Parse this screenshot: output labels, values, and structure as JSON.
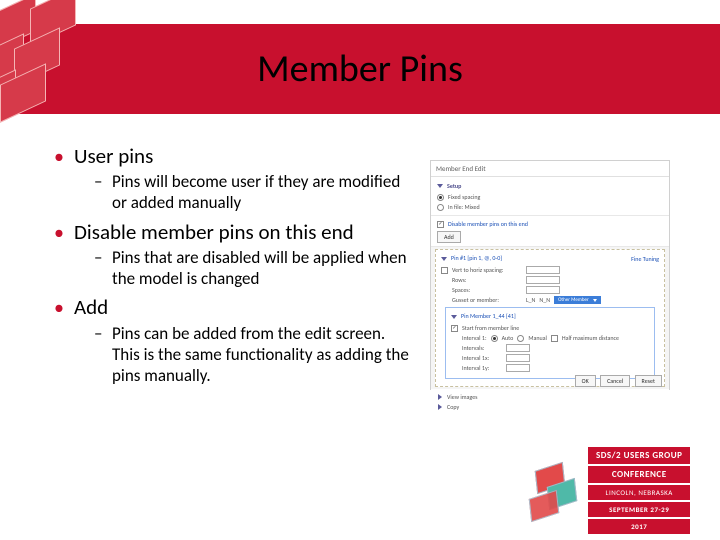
{
  "title": "Member Pins",
  "bullets": [
    {
      "label": "User pins",
      "subs": [
        "Pins will become user if they are modified or added manually"
      ]
    },
    {
      "label": "Disable member pins on this end",
      "subs": [
        "Pins that are disabled will be applied when the model is changed"
      ]
    },
    {
      "label": "Add",
      "subs": [
        "Pins can be added from the edit screen. This is the same functionality as adding the pins manually."
      ]
    }
  ],
  "screenshot": {
    "window_title": "Member End Edit",
    "tab1": "Setup",
    "radio1": "Fixed spacing",
    "radio2": "In file: Mixed",
    "toggle_dis": "Disable member pins on this end",
    "add_btn": "Add",
    "pin_group_title": "Pin #1 [pin 1, @, 0-0]",
    "fine_tuning": "Fine Tuning",
    "vert_spacing_row": "Vert to horiz spacing:",
    "rows_row": "Rows:",
    "spaces_row": "Spaces:",
    "gusset_row": "Gusset or member:",
    "gusset_val_a": "L_N",
    "gusset_val_b": "N_N",
    "dropdown_val": "Other Member",
    "member_title": "Pin Member 1_44 [41]",
    "start_row": "Start from member line",
    "interval_label": "Interval 1:",
    "interval_auto": "Auto",
    "interval_manual": "Manual",
    "half_label": "Half maximum distance",
    "intervals": "Intervals:",
    "interval_1x": "Interval 1x:",
    "interval_1y": "Interval 1y:",
    "bottom_view": "View images",
    "bottom_copy": "Copy",
    "ok_btn": "OK",
    "cancel_btn": "Cancel",
    "reset_btn": "Reset"
  },
  "badge": {
    "line1": "SDS/2 USERS GROUP",
    "line2": "CONFERENCE",
    "line3": "LINCOLN, NEBRASKA",
    "line4": "SEPTEMBER 27-29",
    "line5": "2017"
  }
}
